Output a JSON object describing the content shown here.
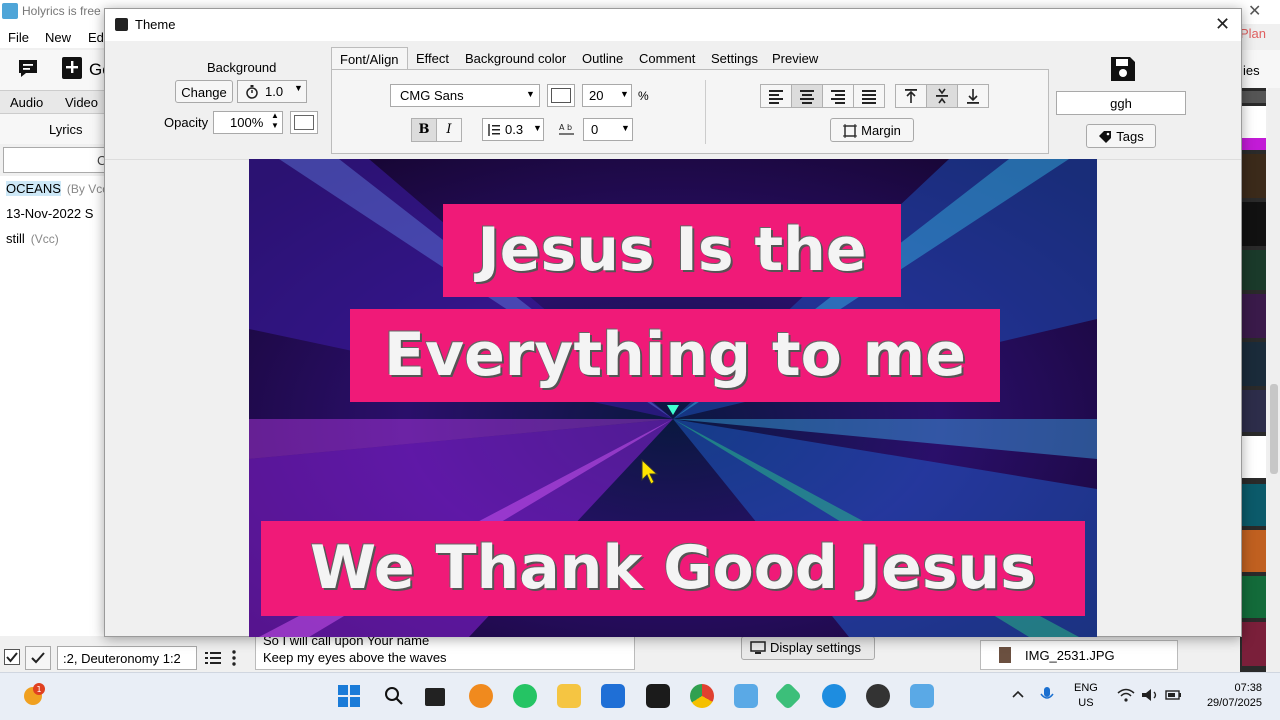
{
  "app": {
    "title": "Holyrics is free",
    "menu": [
      "File",
      "New",
      "Edi"
    ],
    "plan_label": "Plan",
    "toolbar_partial": "Ge",
    "tabs": [
      "Audio",
      "Video"
    ],
    "lyrics_label": "Lyrics",
    "search_partial": "C",
    "songs": [
      {
        "title": "OCEANS",
        "by": "(By Vcc"
      },
      {
        "title": "13-Nov-2022 S",
        "by": ""
      },
      {
        "title": "still",
        "by": "(Vcc)"
      }
    ],
    "right_tab_partial": "ies",
    "verse_ref": ":2, Deuteronomy 1:2",
    "preview_lines": [
      "So I will call upon Your name",
      "Keep my eyes above the waves"
    ],
    "display_settings_label": "Display settings",
    "image_file": "IMG_2531.JPG"
  },
  "dialog": {
    "title": "Theme",
    "background_label": "Background",
    "change_label": "Change",
    "speed_value": "1.0",
    "opacity_label": "Opacity",
    "opacity_value": "100%",
    "tabs": [
      "Font/Align",
      "Effect",
      "Background color",
      "Outline",
      "Comment",
      "Settings",
      "Preview"
    ],
    "font_name": "CMG Sans",
    "font_size": "20",
    "percent": "%",
    "line_spacing": "0.3",
    "char_spacing": "0",
    "margin_label": "Margin",
    "name_value": "ggh",
    "tags_label": "Tags",
    "bold_glyph": "B",
    "italic_glyph": "I"
  },
  "preview": {
    "line1": "Jesus Is the",
    "line2": "Everything to me",
    "line3": "We Thank Good Jesus",
    "box_color": "#f01a78"
  },
  "taskbar": {
    "lang_top": "ENG",
    "lang_bottom": "US",
    "time": "07:38",
    "date": "29/07/2025",
    "badge": "1"
  }
}
